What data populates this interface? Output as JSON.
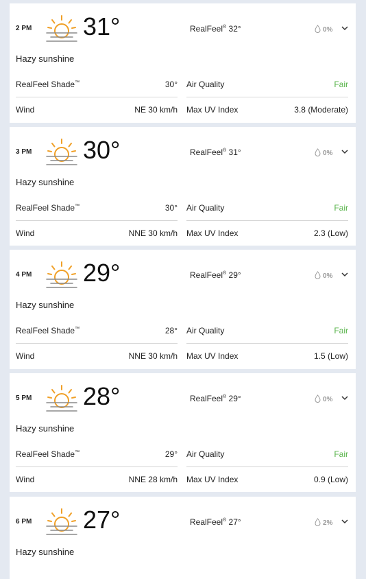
{
  "hours": [
    {
      "time": "2 PM",
      "temp": "31°",
      "realfeel_label": "RealFeel",
      "realfeel": "32°",
      "precip": "0%",
      "phrase": "Hazy sunshine",
      "shade_label": "RealFeel Shade",
      "shade": "30°",
      "aq_label": "Air Quality",
      "aq": "Fair",
      "wind_label": "Wind",
      "wind": "NE 30 km/h",
      "uv_label": "Max UV Index",
      "uv": "3.8 (Moderate)"
    },
    {
      "time": "3 PM",
      "temp": "30°",
      "realfeel_label": "RealFeel",
      "realfeel": "31°",
      "precip": "0%",
      "phrase": "Hazy sunshine",
      "shade_label": "RealFeel Shade",
      "shade": "30°",
      "aq_label": "Air Quality",
      "aq": "Fair",
      "wind_label": "Wind",
      "wind": "NNE 30 km/h",
      "uv_label": "Max UV Index",
      "uv": "2.3 (Low)"
    },
    {
      "time": "4 PM",
      "temp": "29°",
      "realfeel_label": "RealFeel",
      "realfeel": "29°",
      "precip": "0%",
      "phrase": "Hazy sunshine",
      "shade_label": "RealFeel Shade",
      "shade": "28°",
      "aq_label": "Air Quality",
      "aq": "Fair",
      "wind_label": "Wind",
      "wind": "NNE 30 km/h",
      "uv_label": "Max UV Index",
      "uv": "1.5 (Low)"
    },
    {
      "time": "5 PM",
      "temp": "28°",
      "realfeel_label": "RealFeel",
      "realfeel": "29°",
      "precip": "0%",
      "phrase": "Hazy sunshine",
      "shade_label": "RealFeel Shade",
      "shade": "29°",
      "aq_label": "Air Quality",
      "aq": "Fair",
      "wind_label": "Wind",
      "wind": "NNE 28 km/h",
      "uv_label": "Max UV Index",
      "uv": "0.9 (Low)"
    },
    {
      "time": "6 PM",
      "temp": "27°",
      "realfeel_label": "RealFeel",
      "realfeel": "27°",
      "precip": "2%",
      "phrase": "Hazy sunshine"
    }
  ],
  "icons": {
    "weather": "hazy-sun-icon",
    "precip": "raindrop-icon",
    "expand": "chevron-down-icon"
  },
  "colors": {
    "background": "#e4e9f1",
    "air_quality_fair": "#58b44a",
    "sun": "#f0a028"
  }
}
